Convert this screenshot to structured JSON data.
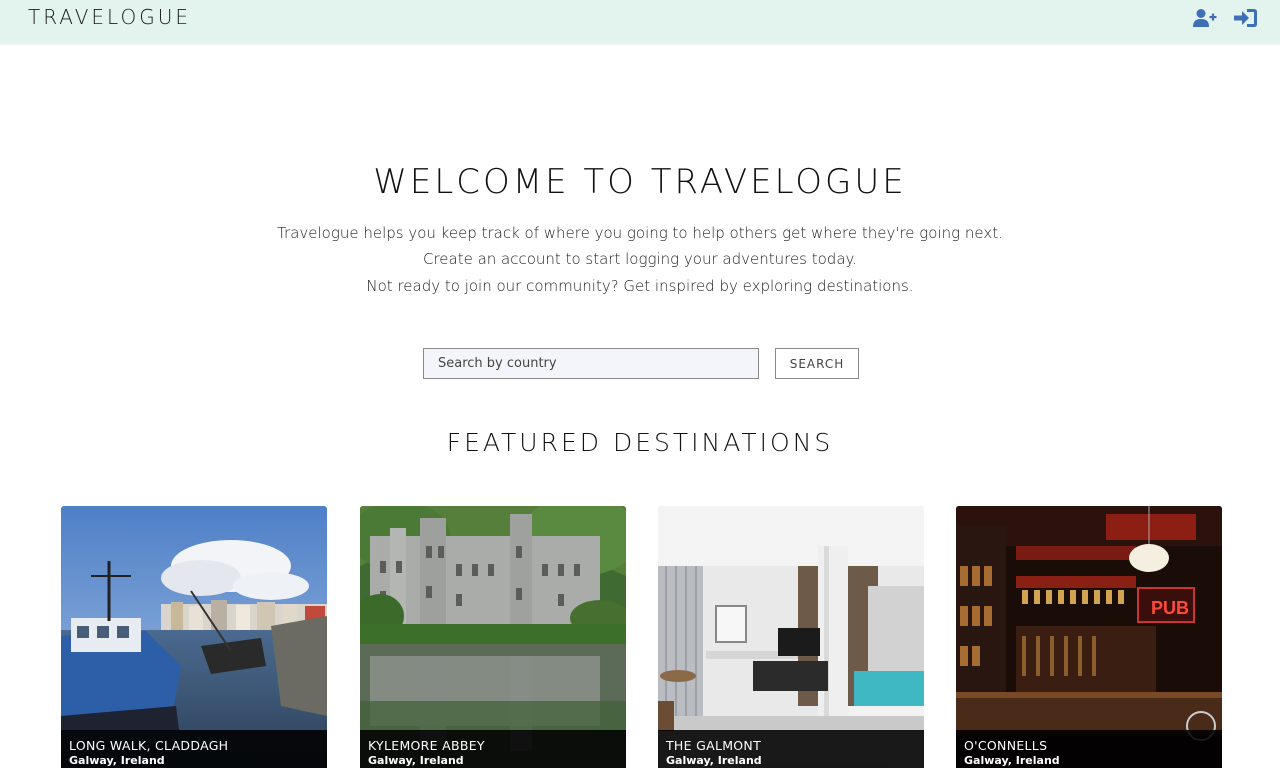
{
  "nav": {
    "brand": "TRAVELOGUE",
    "accent_color": "#3f6fb5",
    "background_color": "#e3f3ee",
    "icons": [
      "user-plus-icon",
      "sign-in-icon"
    ]
  },
  "hero": {
    "title": "WELCOME TO TRAVELOGUE",
    "line1": "Travelogue helps you keep track of where you going to help others get where they're going next.",
    "line2": "Create an account to start logging your adventures today.",
    "line3": "Not ready to join our community? Get inspired by exploring destinations."
  },
  "search": {
    "placeholder": "Search by country",
    "value": "",
    "button_label": "SEARCH"
  },
  "featured": {
    "title": "FEATURED DESTINATIONS",
    "cards": [
      {
        "title": "LONG WALK, CLADDAGH",
        "location": "Galway, Ireland"
      },
      {
        "title": "KYLEMORE ABBEY",
        "location": "Galway, Ireland"
      },
      {
        "title": "THE GALMONT",
        "location": "Galway, Ireland"
      },
      {
        "title": "O'CONNELLS",
        "location": "Galway, Ireland"
      }
    ]
  }
}
